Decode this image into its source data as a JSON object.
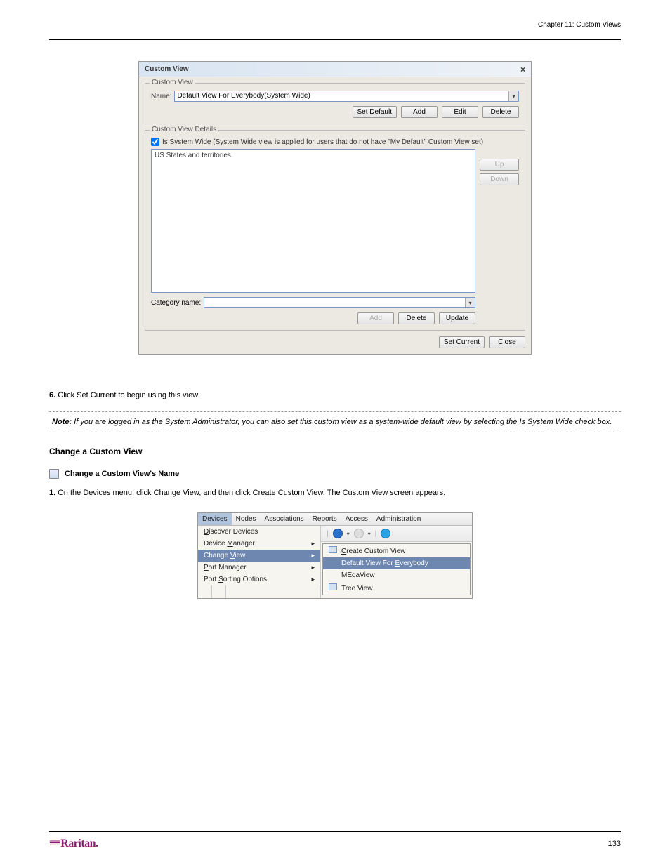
{
  "header": {
    "chapter": "Chapter 11: Custom Views"
  },
  "dialog": {
    "title": "Custom View",
    "section1": {
      "legend": "Custom View",
      "name_label": "Name:",
      "name_value": "Default View For Everybody(System Wide)",
      "buttons": {
        "set_default": "Set Default",
        "add": "Add",
        "edit": "Edit",
        "delete": "Delete"
      }
    },
    "section2": {
      "legend": "Custom View Details",
      "checkbox_label": "Is System Wide (System Wide view is applied for users that do not have \"My Default\" Custom View set)",
      "list_item": "US States and territories",
      "buttons_side": {
        "up": "Up",
        "down": "Down"
      },
      "category_label": "Category name:",
      "buttons_bottom": {
        "add": "Add",
        "delete": "Delete",
        "update": "Update"
      }
    },
    "footer_buttons": {
      "set_current": "Set Current",
      "close": "Close"
    }
  },
  "text": {
    "step6": "6.",
    "step6_text": " Click Set Current to begin using this view.",
    "heading_change": "Change a Custom View",
    "heading_change_name": "Change a Custom View's Name",
    "step1": "1.",
    "step1_text": " On the Devices menu, click Change View, and then click Create Custom View. The Custom View screen appears."
  },
  "note": {
    "label": "Note:",
    "text": " If you are logged in as the System Administrator, you can also set this custom view as a system-wide default view by selecting the Is System Wide check box."
  },
  "menu_shot": {
    "menubar": [
      "Devices",
      "Nodes",
      "Associations",
      "Reports",
      "Access",
      "Administration"
    ],
    "menubar_u": [
      "D",
      "N",
      "A",
      "R",
      "A",
      "n"
    ],
    "items_left": [
      {
        "label": "Discover Devices",
        "u": "D",
        "arrow": false
      },
      {
        "label": "Device Manager",
        "u": "M",
        "arrow": true
      },
      {
        "label": "Change View",
        "u": "V",
        "arrow": true,
        "sel": true
      },
      {
        "label": "Port Manager",
        "u": "P",
        "arrow": true
      },
      {
        "label": "Port Sorting Options",
        "u": "S",
        "arrow": true
      }
    ],
    "submenu": [
      {
        "label": "Create Custom View",
        "u": "C",
        "icon": true
      },
      {
        "label": "Default View For Everybody",
        "u": "E",
        "sel": true
      },
      {
        "label": "MEgaView"
      },
      {
        "label": "Tree View",
        "icon": true
      }
    ]
  },
  "footer": {
    "logo": "Raritan.",
    "page": "133"
  }
}
